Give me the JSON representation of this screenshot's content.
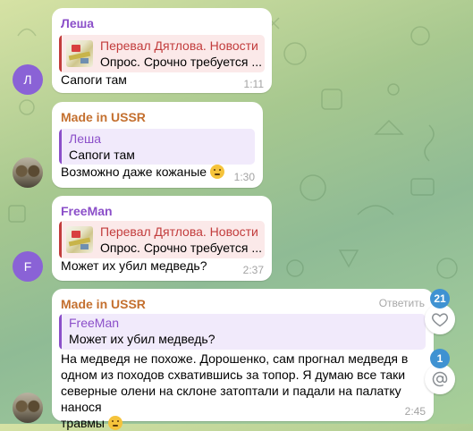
{
  "colors": {
    "red_name": "#c23c3c",
    "orange_name": "#c4702f",
    "purple_name": "#8b4fc9",
    "avatar_purple": "#8a62d6",
    "badge_blue": "#3f92d2"
  },
  "messages": [
    {
      "sender": "Леша",
      "quote_title": "Перевал Дятлова. Новости",
      "quote_text": "Опрос. Срочно требуется ...",
      "text": "Сапоги там",
      "time": "1:11",
      "avatar_letter": "Л"
    },
    {
      "sender": "Made in USSR",
      "quote_title": "Леша",
      "quote_text": "Сапоги там",
      "text": "Возможно даже кожаные",
      "time": "1:30"
    },
    {
      "sender": "FreeMan",
      "quote_title": "Перевал Дятлова. Новости",
      "quote_text": "Опрос. Срочно требуется ...",
      "text": "Может их убил медведь?",
      "time": "2:37",
      "avatar_letter": "F"
    },
    {
      "sender": "Made in USSR",
      "reply_label": "Ответить",
      "quote_title": "FreeMan",
      "quote_text": "Может их убил медведь?",
      "text_lines": [
        "На медведя не похоже. Дорошенко, сам прогнал медведя в",
        "одном из походов схватившись за топор. Я думаю все таки",
        "северные олени на склоне затоптали и падали на палатку нанося",
        "травмы"
      ],
      "time": "2:45"
    }
  ],
  "side": {
    "reactions_count": "21",
    "mentions_count": "1",
    "heart_icon": "heart-icon",
    "mention_icon": "at-icon"
  }
}
